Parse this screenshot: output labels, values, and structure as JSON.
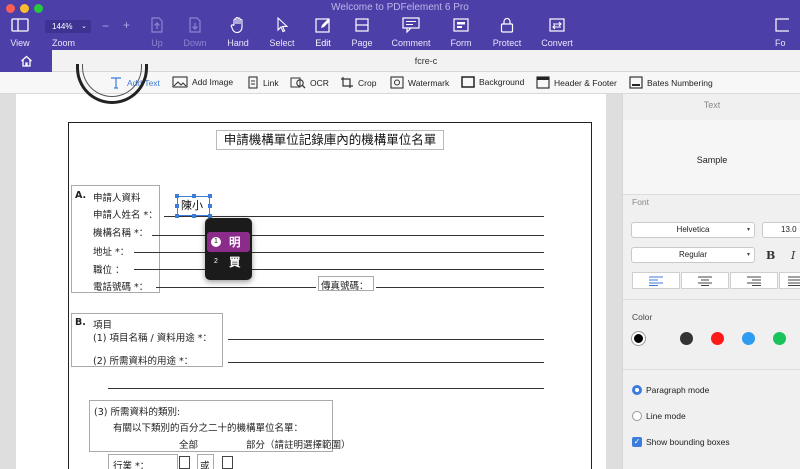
{
  "window": {
    "title": "Welcome to PDFelement 6 Pro"
  },
  "toolbar": {
    "view": "View",
    "zoom_value": "144%",
    "zoom_label": "Zoom",
    "zoom_minus": "−",
    "zoom_plus": "+",
    "up": "Up",
    "down": "Down",
    "hand": "Hand",
    "select": "Select",
    "edit": "Edit",
    "page": "Page",
    "comment": "Comment",
    "form": "Form",
    "protect": "Protect",
    "convert": "Convert",
    "cut_off": "Fo"
  },
  "tabs": {
    "document": "fcre-c"
  },
  "edit_toolbar": {
    "add_text": "Add Text",
    "add_image": "Add Image",
    "link": "Link",
    "ocr": "OCR",
    "crop": "Crop",
    "watermark": "Watermark",
    "background": "Background",
    "header_footer": "Header & Footer",
    "bates": "Bates Numbering"
  },
  "document": {
    "title": "申請機構單位記錄庫內的機構單位名單",
    "section_a": {
      "letter": "A.",
      "heading": "申請人資料",
      "name": "申請人姓名 *：",
      "org": "機構名稱 *：",
      "address": "地址 *：",
      "position": "職位 ：",
      "phone": "電話號碼 *：",
      "fax": "傳真號碼："
    },
    "section_b": {
      "letter": "B.",
      "heading": "項目",
      "item1": "(1) 項目名稱 / 資料用途 *：",
      "item2": "(2) 所需資料的用途 *："
    },
    "section_3": {
      "line1": "(3) 所需資料的類別:",
      "line2": "有關以下類別的百分之二十的機構單位名單：",
      "all": "全部",
      "part": "部分（請註明選擇範圍）",
      "industry": "行業 *：",
      "or": "或"
    },
    "edit_text": "陳小"
  },
  "ime": {
    "candidates": [
      {
        "num": "1",
        "char": "明"
      },
      {
        "num": "2",
        "char": "買"
      }
    ]
  },
  "panel": {
    "header": "Text",
    "sample": "Sample",
    "font_label": "Font",
    "font_family": "Helvetica",
    "font_size": "13.0",
    "font_style": "Regular",
    "bold": "B",
    "italic": "I",
    "color_label": "Color",
    "colors": [
      "#000000",
      "#333333",
      "#ff1a1a",
      "#2d9cf0",
      "#19c35a"
    ],
    "paragraph_mode": "Paragraph mode",
    "line_mode": "Line mode",
    "show_bounding": "Show bounding boxes"
  },
  "colors": {
    "accent": "#4d3fa8",
    "selection": "#3d7bdc"
  }
}
